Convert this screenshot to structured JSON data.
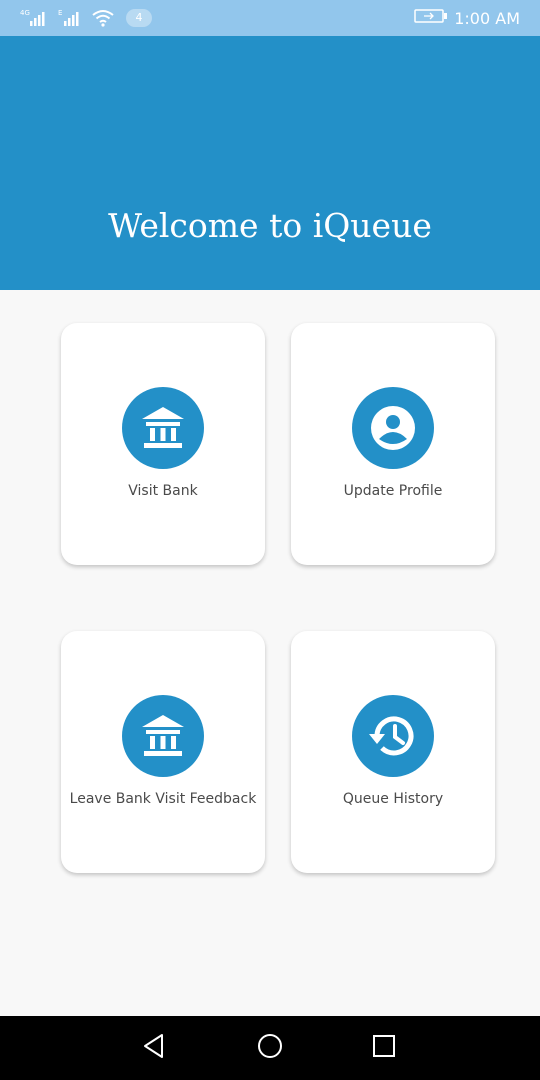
{
  "status_bar": {
    "signal1_label": "4G",
    "signal2_label": "E",
    "notification_count": "4",
    "time": "1:00 AM",
    "icons": [
      "signal-icon",
      "wifi-icon",
      "battery-icon"
    ]
  },
  "header": {
    "title": "Welcome to iQueue"
  },
  "tiles": [
    {
      "label": "Visit Bank",
      "icon": "bank-icon"
    },
    {
      "label": "Update Profile",
      "icon": "profile-icon"
    },
    {
      "label": "Leave Bank Visit Feedback",
      "icon": "bank-icon"
    },
    {
      "label": "Queue History",
      "icon": "history-icon"
    }
  ],
  "nav_bar": {
    "icons": [
      "back-icon",
      "home-icon",
      "recents-icon"
    ]
  },
  "colors": {
    "primary": "#2390c8",
    "status_bar": "#92c6ec",
    "background": "#f8f8f8",
    "card": "#ffffff",
    "label_text": "#4a4a4a"
  }
}
